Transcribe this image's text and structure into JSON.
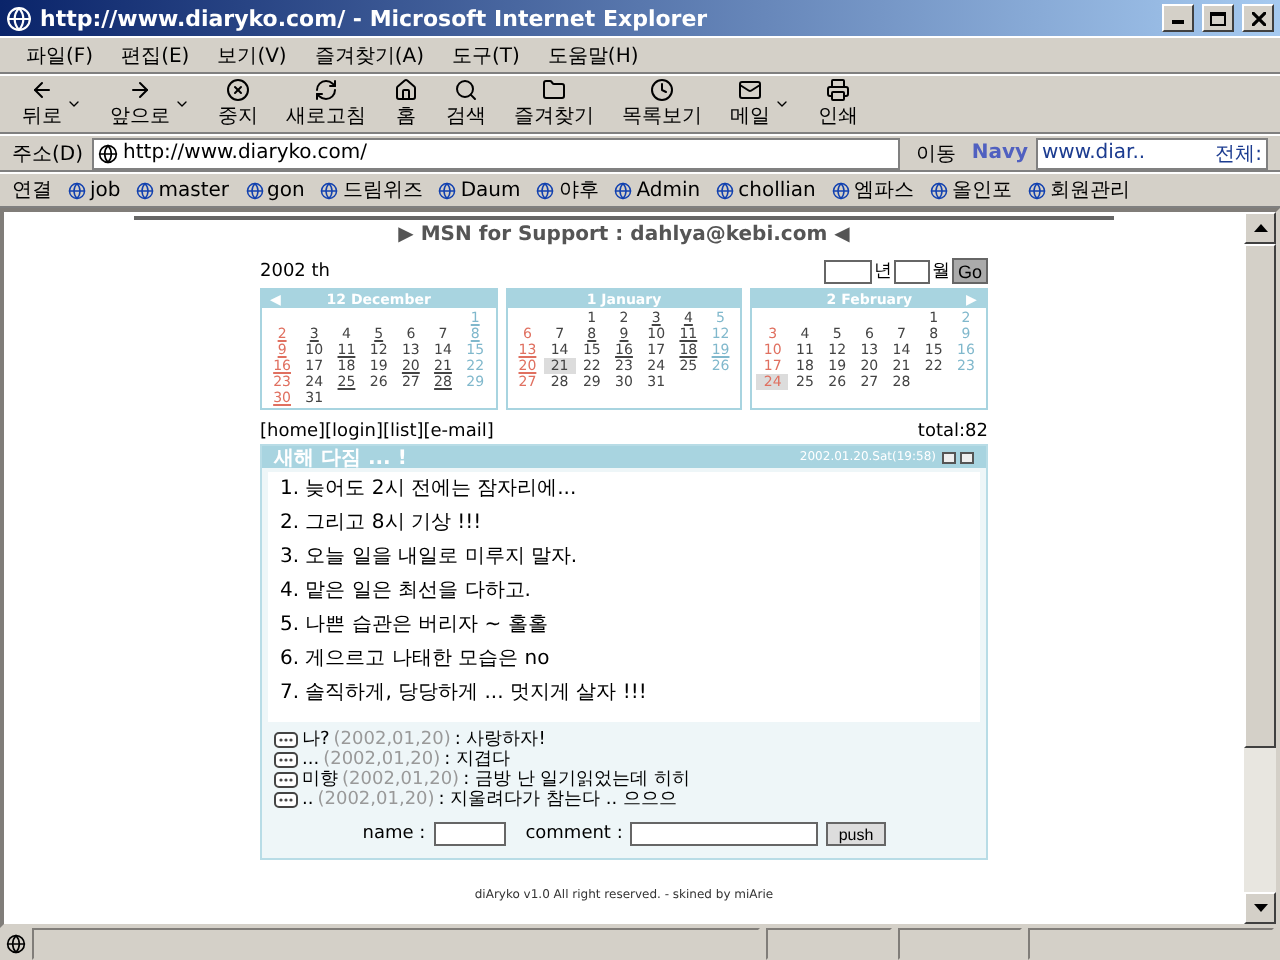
{
  "window": {
    "title": "http://www.diaryko.com/ - Microsoft Internet Explorer"
  },
  "menu": [
    "파일(F)",
    "편집(E)",
    "보기(V)",
    "즐겨찾기(A)",
    "도구(T)",
    "도움말(H)"
  ],
  "toolbar": [
    {
      "label": "뒤로",
      "kind": "back",
      "dropdown": true
    },
    {
      "label": "앞으로",
      "kind": "forward",
      "dropdown": true
    },
    {
      "label": "중지",
      "kind": "stop",
      "dropdown": false
    },
    {
      "label": "새로고침",
      "kind": "refresh",
      "dropdown": false
    },
    {
      "label": "홈",
      "kind": "home",
      "dropdown": false
    },
    {
      "label": "검색",
      "kind": "search",
      "dropdown": false
    },
    {
      "label": "즐겨찾기",
      "kind": "favorites",
      "dropdown": false
    },
    {
      "label": "목록보기",
      "kind": "history",
      "dropdown": false
    },
    {
      "label": "메일",
      "kind": "mail",
      "dropdown": true
    },
    {
      "label": "인쇄",
      "kind": "print",
      "dropdown": false
    }
  ],
  "address": {
    "label": "주소(D)",
    "value": "http://www.diaryko.com/",
    "go": "이동",
    "navy_logo": "Navy",
    "navy_value": "www.diar..",
    "navy_label": "전체:"
  },
  "links": {
    "label": "연결",
    "items": [
      "job",
      "master",
      "gon",
      "드림위즈",
      "Daum",
      "야후",
      "Admin",
      "chollian",
      "엠파스",
      "올인포",
      "회원관리"
    ]
  },
  "page": {
    "banner": "▶ MSN for Support : dahlya@kebi.com ◀",
    "year": "2002 th",
    "year_unit": "년",
    "month_unit": "월",
    "go_button": "Go",
    "months": [
      {
        "title": "12 December",
        "prev": "◀",
        "weeks": [
          {
            "kind": "first",
            "days": [
              {
                "d": "1",
                "linked": true,
                "today": false
              }
            ]
          },
          {
            "kind": "week",
            "days": [
              {
                "d": "2",
                "linked": true,
                "today": false
              },
              {
                "d": "3",
                "linked": true,
                "today": false
              },
              {
                "d": "4",
                "linked": false,
                "today": false
              },
              {
                "d": "5",
                "linked": true,
                "today": false
              },
              {
                "d": "6",
                "linked": false,
                "today": false
              },
              {
                "d": "7",
                "linked": false,
                "today": false
              },
              {
                "d": "8",
                "linked": true,
                "today": false
              }
            ]
          },
          {
            "kind": "week",
            "days": [
              {
                "d": "9",
                "linked": true,
                "today": false
              },
              {
                "d": "10",
                "linked": false,
                "today": false
              },
              {
                "d": "11",
                "linked": true,
                "today": false
              },
              {
                "d": "12",
                "linked": false,
                "today": false
              },
              {
                "d": "13",
                "linked": false,
                "today": false
              },
              {
                "d": "14",
                "linked": false,
                "today": false
              },
              {
                "d": "15",
                "linked": false,
                "today": false
              }
            ]
          },
          {
            "kind": "week",
            "days": [
              {
                "d": "16",
                "linked": true,
                "today": false
              },
              {
                "d": "17",
                "linked": false,
                "today": false
              },
              {
                "d": "18",
                "linked": false,
                "today": false
              },
              {
                "d": "19",
                "linked": false,
                "today": false
              },
              {
                "d": "20",
                "linked": true,
                "today": false
              },
              {
                "d": "21",
                "linked": true,
                "today": false
              },
              {
                "d": "22",
                "linked": false,
                "today": false
              }
            ]
          },
          {
            "kind": "week",
            "days": [
              {
                "d": "23",
                "linked": false,
                "today": false
              },
              {
                "d": "24",
                "linked": false,
                "today": false
              },
              {
                "d": "25",
                "linked": true,
                "today": false
              },
              {
                "d": "26",
                "linked": false,
                "today": false
              },
              {
                "d": "27",
                "linked": false,
                "today": false
              },
              {
                "d": "28",
                "linked": true,
                "today": false
              },
              {
                "d": "29",
                "linked": false,
                "today": false
              }
            ]
          },
          {
            "kind": "week",
            "days": [
              {
                "d": "30",
                "linked": true,
                "today": false
              },
              {
                "d": "31",
                "linked": false,
                "today": false
              }
            ]
          }
        ]
      },
      {
        "title": "1 January",
        "weeks": [
          {
            "kind": "first",
            "days": [
              {
                "d": "1",
                "linked": false,
                "today": false
              },
              {
                "d": "2",
                "linked": false,
                "today": false
              },
              {
                "d": "3",
                "linked": true,
                "today": false
              },
              {
                "d": "4",
                "linked": true,
                "today": false
              },
              {
                "d": "5",
                "linked": false,
                "today": false
              }
            ]
          },
          {
            "kind": "week",
            "days": [
              {
                "d": "6",
                "linked": false,
                "today": false
              },
              {
                "d": "7",
                "linked": false,
                "today": false
              },
              {
                "d": "8",
                "linked": true,
                "today": false
              },
              {
                "d": "9",
                "linked": true,
                "today": false
              },
              {
                "d": "10",
                "linked": false,
                "today": false
              },
              {
                "d": "11",
                "linked": true,
                "today": false
              },
              {
                "d": "12",
                "linked": false,
                "today": false
              }
            ]
          },
          {
            "kind": "week",
            "days": [
              {
                "d": "13",
                "linked": true,
                "today": false
              },
              {
                "d": "14",
                "linked": false,
                "today": false
              },
              {
                "d": "15",
                "linked": false,
                "today": false
              },
              {
                "d": "16",
                "linked": true,
                "today": false
              },
              {
                "d": "17",
                "linked": false,
                "today": false
              },
              {
                "d": "18",
                "linked": true,
                "today": false
              },
              {
                "d": "19",
                "linked": true,
                "today": false
              }
            ]
          },
          {
            "kind": "week",
            "days": [
              {
                "d": "20",
                "linked": true,
                "today": false
              },
              {
                "d": "21",
                "linked": false,
                "today": true
              },
              {
                "d": "22",
                "linked": false,
                "today": false
              },
              {
                "d": "23",
                "linked": false,
                "today": false
              },
              {
                "d": "24",
                "linked": false,
                "today": false
              },
              {
                "d": "25",
                "linked": false,
                "today": false
              },
              {
                "d": "26",
                "linked": false,
                "today": false
              }
            ]
          },
          {
            "kind": "week",
            "days": [
              {
                "d": "27",
                "linked": false,
                "today": false
              },
              {
                "d": "28",
                "linked": false,
                "today": false
              },
              {
                "d": "29",
                "linked": false,
                "today": false
              },
              {
                "d": "30",
                "linked": false,
                "today": false
              },
              {
                "d": "31",
                "linked": false,
                "today": false
              }
            ]
          }
        ]
      },
      {
        "title": "2 February",
        "next": "▶",
        "weeks": [
          {
            "kind": "first",
            "days": [
              {
                "d": "1",
                "linked": false,
                "today": false
              },
              {
                "d": "2",
                "linked": false,
                "today": false
              }
            ]
          },
          {
            "kind": "week",
            "days": [
              {
                "d": "3",
                "linked": false,
                "today": false
              },
              {
                "d": "4",
                "linked": false,
                "today": false
              },
              {
                "d": "5",
                "linked": false,
                "today": false
              },
              {
                "d": "6",
                "linked": false,
                "today": false
              },
              {
                "d": "7",
                "linked": false,
                "today": false
              },
              {
                "d": "8",
                "linked": false,
                "today": false
              },
              {
                "d": "9",
                "linked": false,
                "today": false
              }
            ]
          },
          {
            "kind": "week",
            "days": [
              {
                "d": "10",
                "linked": false,
                "today": false
              },
              {
                "d": "11",
                "linked": false,
                "today": false
              },
              {
                "d": "12",
                "linked": false,
                "today": false
              },
              {
                "d": "13",
                "linked": false,
                "today": false
              },
              {
                "d": "14",
                "linked": false,
                "today": false
              },
              {
                "d": "15",
                "linked": false,
                "today": false
              },
              {
                "d": "16",
                "linked": false,
                "today": false
              }
            ]
          },
          {
            "kind": "week",
            "days": [
              {
                "d": "17",
                "linked": false,
                "today": false
              },
              {
                "d": "18",
                "linked": false,
                "today": false
              },
              {
                "d": "19",
                "linked": false,
                "today": false
              },
              {
                "d": "20",
                "linked": false,
                "today": false
              },
              {
                "d": "21",
                "linked": false,
                "today": false
              },
              {
                "d": "22",
                "linked": false,
                "today": false
              },
              {
                "d": "23",
                "linked": false,
                "today": false
              }
            ]
          },
          {
            "kind": "week",
            "days": [
              {
                "d": "24",
                "linked": false,
                "today": true
              },
              {
                "d": "25",
                "linked": false,
                "today": false
              },
              {
                "d": "26",
                "linked": false,
                "today": false
              },
              {
                "d": "27",
                "linked": false,
                "today": false
              },
              {
                "d": "28",
                "linked": false,
                "today": false
              }
            ]
          }
        ]
      }
    ],
    "nav": [
      "[home]",
      "[login]",
      "[list]",
      "[e-mail]"
    ],
    "total": "total:82",
    "entry": {
      "title": "새해 다짐 ... !",
      "date": "2002.01.20.Sat(19:58)",
      "lines": [
        "1. 늦어도 2시 전에는 잠자리에...",
        "2. 그리고 8시 기상 !!!",
        "3. 오늘 일을 내일로 미루지 말자.",
        "4. 맡은 일은 최선을 다하고.",
        "5. 나쁜 습관은 버리자 ~ 홀홀",
        "6. 게으르고 나태한 모습은 no",
        "7. 솔직하게, 당당하게 ... 멋지게 살자 !!!"
      ],
      "comments": [
        {
          "name": "나?",
          "date": "(2002,01,20)",
          "text": ": 사랑하자!"
        },
        {
          "name": "...",
          "date": "(2002,01,20)",
          "text": ": 지겹다"
        },
        {
          "name": "미향",
          "date": "(2002,01,20)",
          "text": ": 금방 난 일기읽었는데 히히"
        },
        {
          "name": "..",
          "date": "(2002,01,20)",
          "text": ": 지울려다가 참는다 .. 으으으"
        }
      ],
      "form": {
        "name_label": "name :",
        "comment_label": "comment :",
        "button": "push"
      }
    },
    "footer": "diAryko v1.0 All right reserved. - skined by miArie"
  }
}
